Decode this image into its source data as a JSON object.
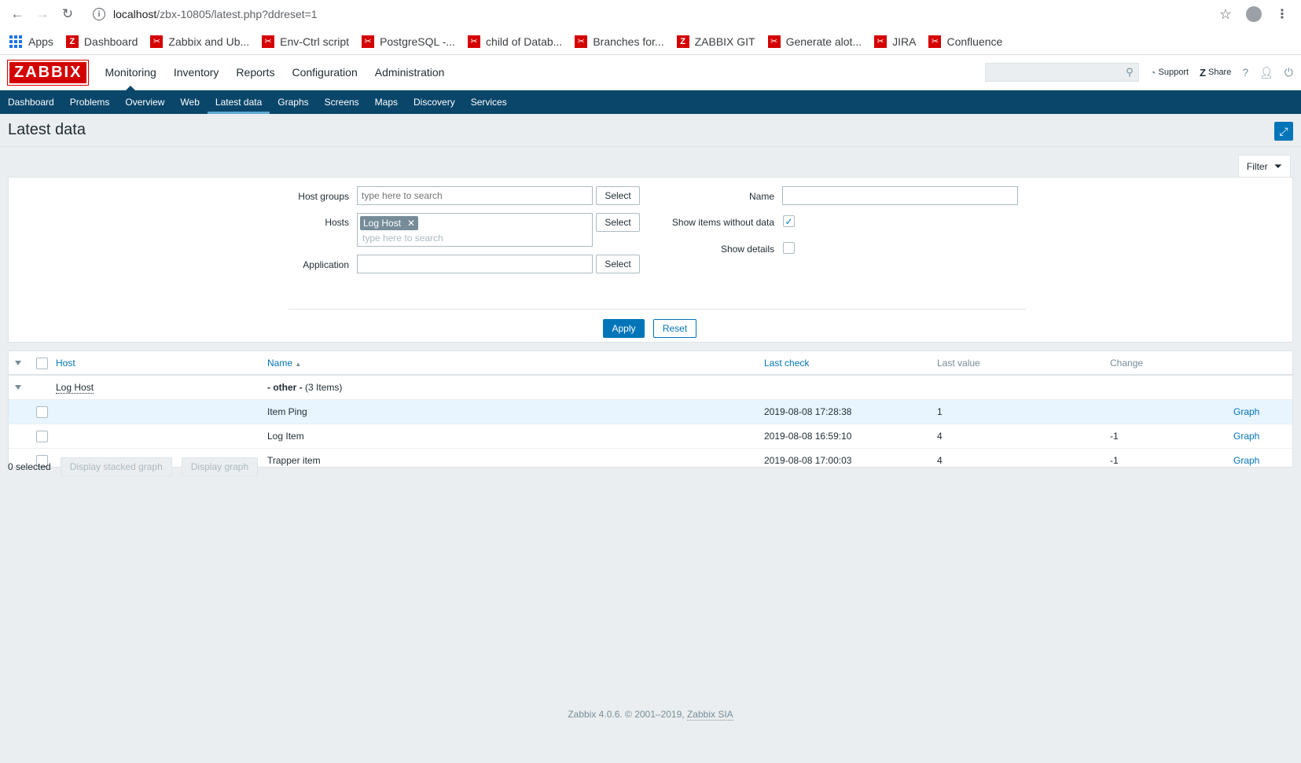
{
  "browser": {
    "url_host": "localhost",
    "url_path": "/zbx-10805/latest.php?ddreset=1",
    "bookmarks": [
      {
        "label": "Apps",
        "kind": "apps"
      },
      {
        "label": "Dashboard",
        "kind": "zabbix"
      },
      {
        "label": "Zabbix and Ub...",
        "kind": "scissors"
      },
      {
        "label": "Env-Ctrl script",
        "kind": "scissors"
      },
      {
        "label": "PostgreSQL -...",
        "kind": "scissors"
      },
      {
        "label": "child of Datab...",
        "kind": "scissors"
      },
      {
        "label": "Branches for...",
        "kind": "scissors"
      },
      {
        "label": "ZABBIX GIT",
        "kind": "zabbix"
      },
      {
        "label": "Generate alot...",
        "kind": "scissors"
      },
      {
        "label": "JIRA",
        "kind": "scissors"
      },
      {
        "label": "Confluence",
        "kind": "scissors"
      }
    ]
  },
  "header": {
    "logo": "ZABBIX",
    "menu": [
      "Monitoring",
      "Inventory",
      "Reports",
      "Configuration",
      "Administration"
    ],
    "active_menu": "Monitoring",
    "support": "Support",
    "share": "Share",
    "help": "?"
  },
  "subnav": {
    "items": [
      "Dashboard",
      "Problems",
      "Overview",
      "Web",
      "Latest data",
      "Graphs",
      "Screens",
      "Maps",
      "Discovery",
      "Services"
    ],
    "active": "Latest data"
  },
  "page": {
    "title": "Latest data"
  },
  "filter": {
    "tab_label": "Filter",
    "host_groups_label": "Host groups",
    "host_groups_placeholder": "type here to search",
    "hosts_label": "Hosts",
    "hosts_tag": "Log Host",
    "hosts_placeholder": "type here to search",
    "application_label": "Application",
    "application_value": "",
    "select_label": "Select",
    "name_label": "Name",
    "name_value": "",
    "show_items_without_data_label": "Show items without data",
    "show_items_without_data_checked": true,
    "show_details_label": "Show details",
    "show_details_checked": false,
    "apply_label": "Apply",
    "reset_label": "Reset"
  },
  "table": {
    "columns": {
      "host": "Host",
      "name": "Name",
      "last_check": "Last check",
      "last_value": "Last value",
      "change": "Change"
    },
    "sort_indicator": "▲",
    "group": {
      "host": "Log Host",
      "application": "- other -",
      "count": "(3 Items)"
    },
    "rows": [
      {
        "name": "Item Ping",
        "last_check": "2019-08-08 17:28:38",
        "last_value": "1",
        "change": "",
        "link": "Graph"
      },
      {
        "name": "Log Item",
        "last_check": "2019-08-08 16:59:10",
        "last_value": "4",
        "change": "-1",
        "link": "Graph"
      },
      {
        "name": "Trapper item",
        "last_check": "2019-08-08 17:00:03",
        "last_value": "4",
        "change": "-1",
        "link": "Graph"
      }
    ]
  },
  "actions": {
    "selected": "0 selected",
    "stacked_graph": "Display stacked graph",
    "graph": "Display graph"
  },
  "footer": {
    "text": "Zabbix 4.0.6. © 2001–2019,",
    "link": "Zabbix SIA"
  }
}
